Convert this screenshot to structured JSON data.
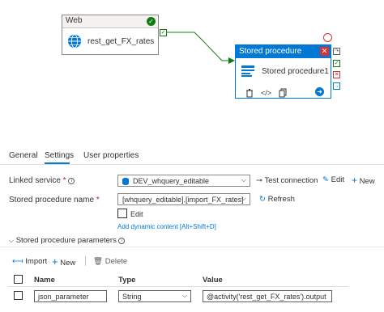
{
  "canvas": {
    "web_activity": {
      "type_label": "Web",
      "name": "rest_get_FX_rates"
    },
    "sp_activity": {
      "type_label": "Stored procedure",
      "name": "Stored procedure1"
    }
  },
  "tabs": [
    {
      "label": "General"
    },
    {
      "label": "Settings"
    },
    {
      "label": "User properties"
    }
  ],
  "form": {
    "linked_service": {
      "label": "Linked service",
      "required_mark": "*",
      "value": "DEV_whquery_editable",
      "test_connection": "Test connection",
      "edit": "Edit",
      "new": "New"
    },
    "sp_name": {
      "label": "Stored procedure name",
      "required_mark": "*",
      "value": "[whquery_editable].[import_FX_rates]",
      "refresh": "Refresh",
      "edit_checkbox_label": "Edit",
      "dynamic_content_link": "Add dynamic content [Alt+Shift+D]"
    }
  },
  "params_section": {
    "title": "Stored procedure parameters",
    "toolbar": {
      "import": "Import",
      "new": "New",
      "delete": "Delete"
    },
    "columns": [
      "Name",
      "Type",
      "Value"
    ],
    "rows": [
      {
        "name": "json_parameter",
        "type": "String",
        "value": "@activity('rest_get_FX_rates').output"
      }
    ]
  },
  "colors": {
    "accent": "#0078d4",
    "success": "#107c10",
    "error": "#d13438"
  }
}
